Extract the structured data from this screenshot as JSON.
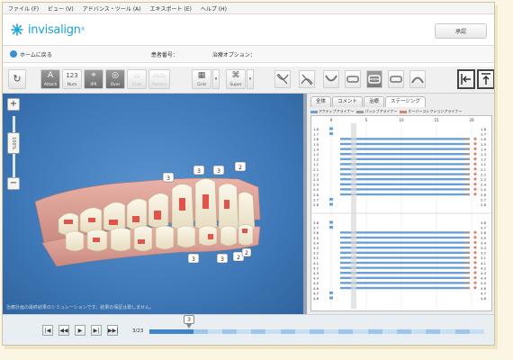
{
  "menu": {
    "items": [
      "ファイル (F)",
      "ビュー (V)",
      "アドバンス・ツール (A)",
      "エキスポート (E)",
      "ヘルプ (H)"
    ]
  },
  "brand": {
    "logo_text": "invisalign",
    "approve_label": "承認"
  },
  "patient": {
    "home_label": "ホームに戻る",
    "patient_no_label": "患者番号：",
    "treatment_option_label": "治療オプション："
  },
  "toolbar": {
    "buttons": [
      {
        "glyph": "A",
        "label": "Attach"
      },
      {
        "glyph": "123",
        "label": "Num"
      },
      {
        "glyph": "⌖",
        "label": "IPR"
      },
      {
        "glyph": "◎",
        "label": "Over"
      },
      {
        "glyph": "⌓",
        "label": "Enet"
      },
      {
        "glyph": "⌓⌓",
        "label": "Pontics"
      },
      {
        "glyph": "▦",
        "label": "Grid"
      },
      {
        "glyph": "⌘",
        "label": "Super"
      }
    ],
    "drop_glyph": "▾"
  },
  "viewer": {
    "zoom_label": "100%",
    "caption": "治療計画の最終結果のシミュレーションです。結果の保証は致しません。",
    "tags": [
      "3",
      "3",
      "3",
      "2",
      "3",
      "3",
      "2",
      "3",
      "2"
    ]
  },
  "panel": {
    "tabs": [
      "全体",
      "コメント",
      "治療",
      "ステージング"
    ],
    "legend": [
      "アクティブアライナー",
      "パッシブアライナー",
      "オーバーコレクションアライナー"
    ],
    "axis_ticks": [
      "0",
      "5",
      "10",
      "15",
      "20"
    ],
    "tooth_labels_upper": [
      "1.8",
      "1.7",
      "1.6",
      "1.5",
      "1.4",
      "1.3",
      "1.2",
      "1.1",
      "2.1",
      "2.2",
      "2.3",
      "2.4",
      "2.5",
      "2.6",
      "2.7",
      "2.8"
    ],
    "tooth_labels_lower": [
      "3.8",
      "3.7",
      "3.6",
      "3.5",
      "3.4",
      "3.3",
      "3.2",
      "3.1",
      "4.1",
      "4.2",
      "4.3",
      "4.4",
      "4.5",
      "4.6",
      "4.7",
      "4.8"
    ]
  },
  "timeline": {
    "stage_counter": "3/23",
    "current_stage": "3",
    "current_stage_value": 3,
    "total_stages": 23,
    "controls": [
      "|◀",
      "◀◀",
      "▶",
      "▶|",
      "▶▶|"
    ]
  },
  "colors": {
    "brand": "#1aa3d8",
    "active_aligner": "#6aa0d8",
    "passive_aligner": "#9a9a9a",
    "overcorrection": "#d9826a",
    "viewer_bg": "#4a84c4"
  }
}
